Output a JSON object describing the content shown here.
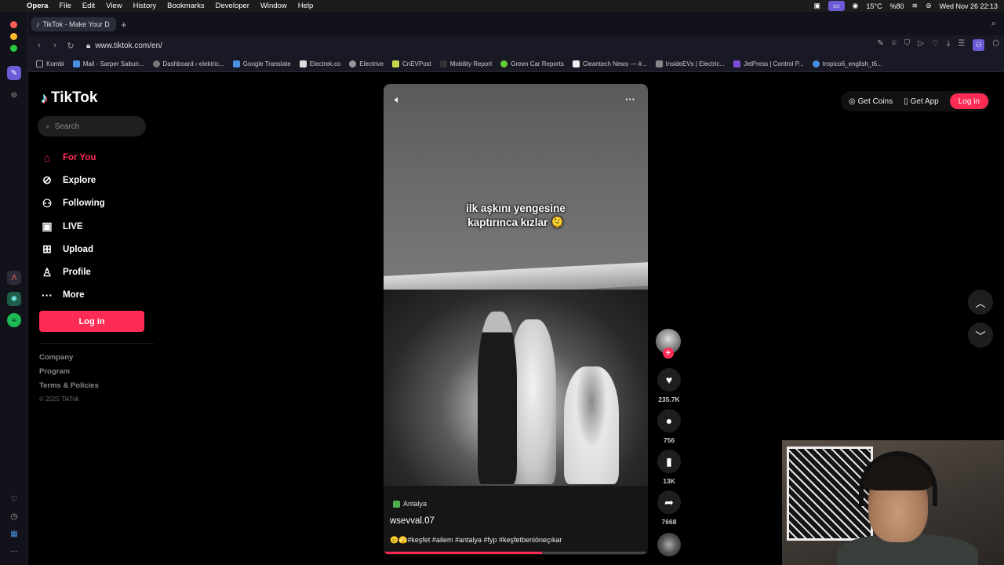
{
  "menubar": {
    "app": "Opera",
    "items": [
      "File",
      "Edit",
      "View",
      "History",
      "Bookmarks",
      "Developer",
      "Window",
      "Help"
    ],
    "weather": "15°C",
    "battery": "%80",
    "datetime": "Wed Nov 26  22:13"
  },
  "browser": {
    "tab_title": "TikTok - Make Your D",
    "url": "www.tiktok.com/en/",
    "bookmarks": [
      "Kombi",
      "Mail - Sarper Sabun...",
      "Dashboard ‹ elektric...",
      "Google Translate",
      "Electrek.co",
      "Electrive",
      "CnEVPost",
      "Mobility Report",
      "Green Car Reports",
      "Cleantech News — #...",
      "InsideEVs | Electric...",
      "JetPress | Control P...",
      "tropico6_english_t6..."
    ]
  },
  "tiktok": {
    "logo": "TikTok",
    "search_placeholder": "Search",
    "nav": {
      "for_you": "For You",
      "explore": "Explore",
      "following": "Following",
      "live": "LIVE",
      "upload": "Upload",
      "profile": "Profile",
      "more": "More"
    },
    "login_side": "Log in",
    "footer": {
      "company": "Company",
      "program": "Program",
      "terms": "Terms & Policies",
      "copyright": "© 2025 TikTok"
    },
    "header": {
      "get_coins": "Get Coins",
      "get_app": "Get App",
      "login": "Log in"
    },
    "video": {
      "overlay_line1": "ilk aşkını yengesine",
      "overlay_line2": "kaptırınca kızlar 🫠",
      "location": "Antalya",
      "author": "wsevval.07",
      "description": "😑🫣#keşfet #ailem #antalya #fyp #keşfetbenióneçıkar",
      "progress": 0.6
    },
    "actions": {
      "likes": "235.7K",
      "comments": "756",
      "saves": "13K",
      "shares": "7668"
    }
  },
  "colors": {
    "accent": "#fe2c55",
    "opera_purple": "#6b5bd6"
  }
}
